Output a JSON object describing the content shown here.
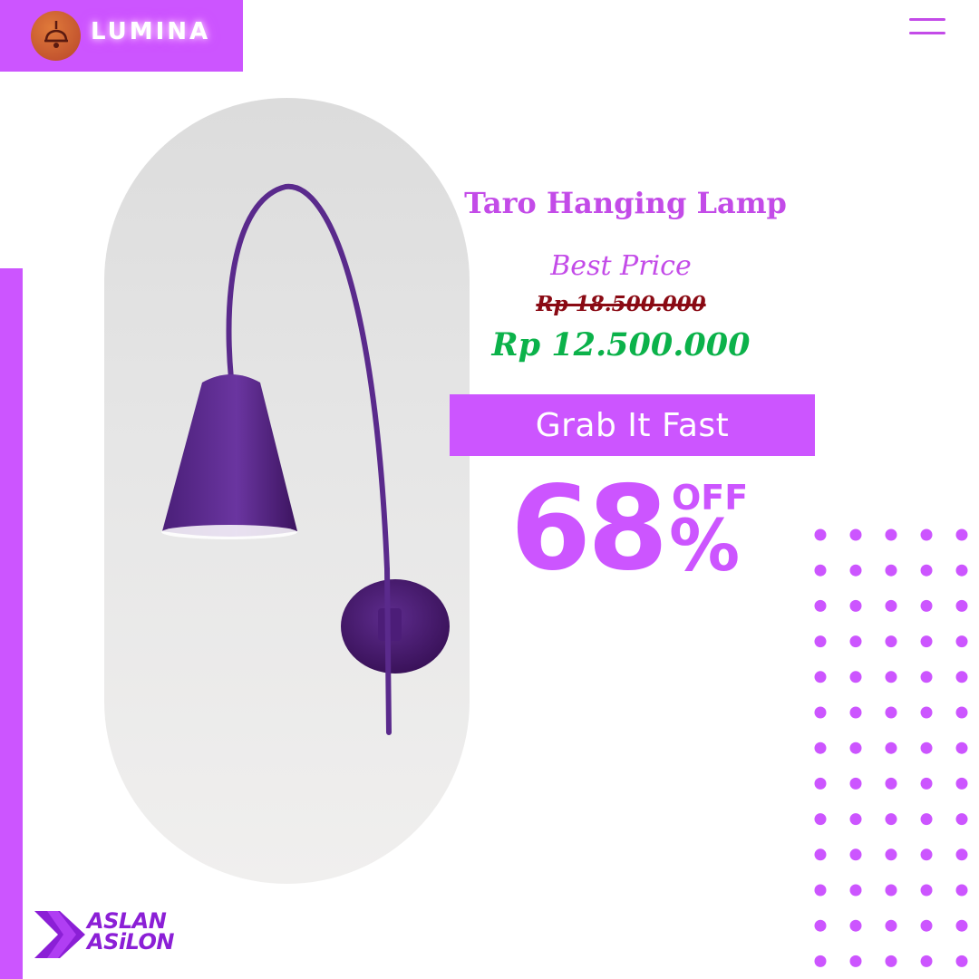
{
  "brand": {
    "name": "LUMINA",
    "logo_icon": "hanging-lamp-icon"
  },
  "header": {
    "menu_icon": "hamburger-menu-icon"
  },
  "product": {
    "title": "Taro Hanging Lamp",
    "tagline": "Best Price",
    "old_price": "Rp 18.500.000",
    "new_price": "Rp 12.500.000"
  },
  "cta": {
    "label": "Grab It Fast"
  },
  "discount": {
    "value": "68",
    "off_label": "OFF",
    "percent_sign": "%"
  },
  "footer_logo": {
    "line1": "ASLAN",
    "line2": "ASiLON"
  },
  "colors": {
    "accent": "#cc55ff",
    "title_purple": "#c34be8",
    "old_price_red": "#8a0a14",
    "new_price_green": "#0bb24a",
    "lamp_purple": "#5c2a8c"
  }
}
